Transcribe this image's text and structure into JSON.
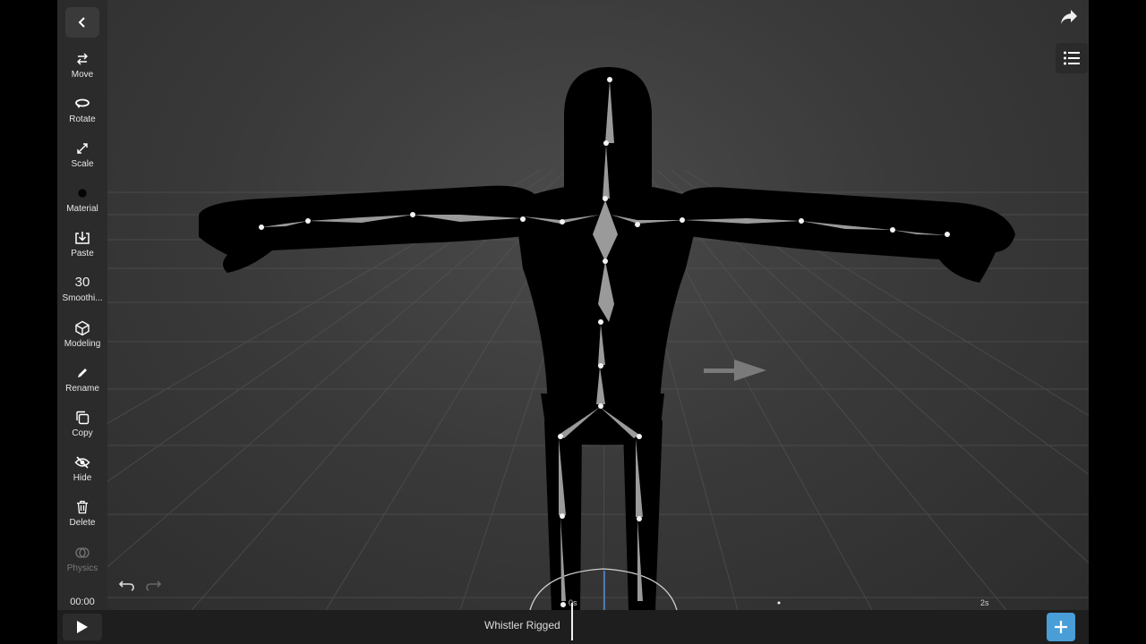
{
  "toolbar": {
    "tools": [
      {
        "id": "move",
        "label": "Move"
      },
      {
        "id": "rotate",
        "label": "Rotate"
      },
      {
        "id": "scale",
        "label": "Scale"
      },
      {
        "id": "material",
        "label": "Material"
      },
      {
        "id": "paste",
        "label": "Paste"
      },
      {
        "id": "smoothing",
        "label": "Smoothi...",
        "value": "30"
      },
      {
        "id": "modeling",
        "label": "Modeling"
      },
      {
        "id": "rename",
        "label": "Rename"
      },
      {
        "id": "copy",
        "label": "Copy"
      },
      {
        "id": "hide",
        "label": "Hide"
      },
      {
        "id": "delete",
        "label": "Delete"
      },
      {
        "id": "physics",
        "label": "Physics",
        "disabled": true
      }
    ]
  },
  "timeline": {
    "current_time": "00:00",
    "clip_name": "Whistler Rigged",
    "tick_start": "0s",
    "tick_end": "2s"
  },
  "colors": {
    "accent": "#4a9ed8",
    "toolbar_bg": "#2b2b2b",
    "viewport_bg": "#3a3a3a"
  },
  "icons": {
    "back": "chevron-left-icon",
    "share": "share-arrow-icon",
    "list": "list-icon",
    "play": "play-icon",
    "add": "plus-icon",
    "undo": "undo-icon",
    "redo": "redo-icon"
  }
}
